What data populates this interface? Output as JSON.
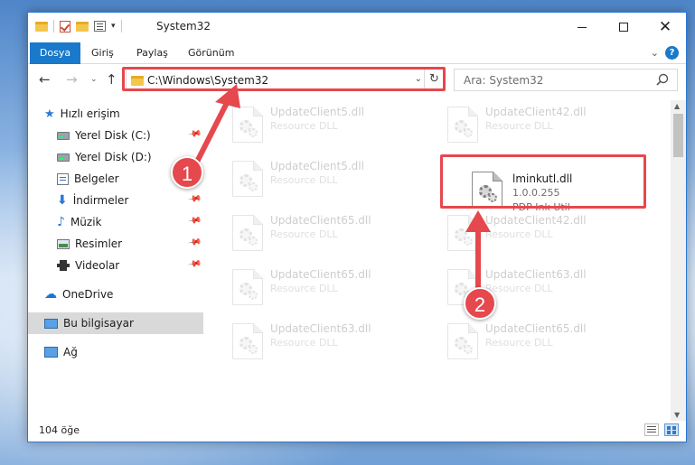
{
  "window": {
    "title": "System32"
  },
  "ribbon": {
    "tabs": [
      "Dosya",
      "Giriş",
      "Paylaş",
      "Görünüm"
    ]
  },
  "navigation": {
    "address": "C:\\Windows\\System32",
    "search_placeholder": "Ara: System32"
  },
  "sidebar": {
    "items": [
      {
        "label": "Hızlı erişim",
        "icon": "star-icon",
        "pinned": false
      },
      {
        "label": "Yerel Disk (C:)",
        "icon": "disk-icon",
        "pinned": true
      },
      {
        "label": "Yerel Disk (D:)",
        "icon": "disk-icon",
        "pinned": false
      },
      {
        "label": "Belgeler",
        "icon": "documents-icon",
        "pinned": true
      },
      {
        "label": "İndirmeler",
        "icon": "download-icon",
        "pinned": true
      },
      {
        "label": "Müzik",
        "icon": "music-icon",
        "pinned": true
      },
      {
        "label": "Resimler",
        "icon": "pictures-icon",
        "pinned": true
      },
      {
        "label": "Videolar",
        "icon": "videos-icon",
        "pinned": true
      },
      {
        "label": "OneDrive",
        "icon": "cloud-icon",
        "pinned": false
      },
      {
        "label": "Bu bilgisayar",
        "icon": "computer-icon",
        "pinned": false,
        "selected": true
      },
      {
        "label": "Ağ",
        "icon": "network-icon",
        "pinned": false
      }
    ]
  },
  "files": [
    {
      "name": "UpdateClient5.dll",
      "line2": "Resource DLL"
    },
    {
      "name": "UpdateClient42.dll",
      "line2": "Resource DLL"
    },
    {
      "name": "UpdateClient5.dll",
      "line2": "Resource DLL"
    },
    {
      "name": "lminkutl.dll",
      "line2": "1.0.0.255",
      "line3": "PDP Ink Util",
      "highlighted": true
    },
    {
      "name": "UpdateClient65.dll",
      "line2": "Resource DLL"
    },
    {
      "name": "UpdateClient42.dll",
      "line2": "Resource DLL"
    },
    {
      "name": "UpdateClient65.dll",
      "line2": "Resource DLL"
    },
    {
      "name": "UpdateClient63.dll",
      "line2": "Resource DLL"
    },
    {
      "name": "UpdateClient63.dll",
      "line2": "Resource DLL"
    },
    {
      "name": "UpdateClient65.dll",
      "line2": "Resource DLL"
    }
  ],
  "status": {
    "item_count": "104 öğe"
  },
  "annotations": {
    "step1": "1",
    "step2": "2",
    "color": "#e5484d"
  },
  "colors": {
    "accent": "#1979ca",
    "selection": "#d9d9d9"
  }
}
